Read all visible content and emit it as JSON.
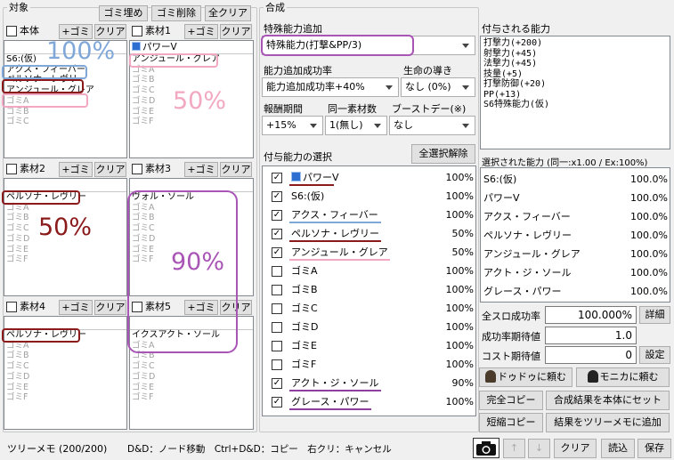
{
  "target": {
    "group_label": "対象",
    "buttons": [
      "ゴミ埋め",
      "ゴミ削除",
      "全クリア"
    ],
    "slot_buttons": {
      "add_gomi": "+ゴミ",
      "clear": "クリア"
    },
    "slots": [
      {
        "name": "本体",
        "header": "",
        "items": [
          "S6:(仮)",
          "アクス・フィーバー",
          "ペルソナ・レヴリー",
          "アンジュール・グレア"
        ],
        "gomi": [
          "ゴミA",
          "ゴミB",
          "ゴミC"
        ],
        "annotation": "100%",
        "annotation_color": "#7fa7d8"
      },
      {
        "name": "素材1",
        "header": "パワーV",
        "items": [
          "アンジュール・グレア"
        ],
        "gomi": [
          "ゴミA",
          "ゴミB",
          "ゴミC",
          "ゴミD",
          "ゴミE",
          "ゴミF"
        ],
        "annotation": "50%",
        "annotation_color": "#f2a8c0"
      },
      {
        "name": "素材2",
        "header": "ペルソナ・レヴリー",
        "items": [],
        "gomi": [
          "ゴミA",
          "ゴミB",
          "ゴミC",
          "ゴミD",
          "ゴミE",
          "ゴミF"
        ],
        "annotation": "50%",
        "annotation_color": "#8b1a1a"
      },
      {
        "name": "素材3",
        "header": "ヴォル・ソール",
        "items": [],
        "gomi": [
          "ゴミA",
          "ゴミB",
          "ゴミC",
          "ゴミD",
          "ゴミE",
          "ゴミF"
        ],
        "annotation": "90%",
        "annotation_color": "#a855b5"
      },
      {
        "name": "素材4",
        "header": "ペルソナ・レヴリー",
        "items": [],
        "gomi": [
          "ゴミA",
          "ゴミB",
          "ゴミC",
          "ゴミD",
          "ゴミE",
          "ゴミF"
        ],
        "annotation": "",
        "annotation_color": ""
      },
      {
        "name": "素材5",
        "header": "イクスアクト・ソール",
        "items": [],
        "gomi": [
          "ゴミA",
          "ゴミB",
          "ゴミC",
          "ゴミD",
          "ゴミE",
          "ゴミF"
        ],
        "annotation": "",
        "annotation_color": ""
      }
    ]
  },
  "synthesis": {
    "group_label": "合成",
    "special_label": "特殊能力追加",
    "special_value": "特殊能力(打撃&PP/3)",
    "rate_label": "能力追加成功率",
    "rate_value": "能力追加成功率+40%",
    "guide_label": "生命の導き",
    "guide_value": "なし (0%)",
    "bonus_label": "報酬期間",
    "bonus_value": "+15%",
    "same_label": "同一素材数",
    "same_value": "1(無し)",
    "boost_label": "ブーストデー(※)",
    "boost_value": "なし",
    "select_label": "付与能力の選択",
    "deselect_all": "全選択解除",
    "abilities": [
      {
        "name": "パワーV",
        "value": "100%",
        "checked": true,
        "icon": true,
        "underline": "#8b1a1a"
      },
      {
        "name": "S6:(仮)",
        "value": "100%",
        "checked": true,
        "icon": false,
        "underline": ""
      },
      {
        "name": "アクス・フィーバー",
        "value": "100%",
        "checked": true,
        "icon": false,
        "underline": "#7fa7d8"
      },
      {
        "name": "ペルソナ・レヴリー",
        "value": "50%",
        "checked": true,
        "icon": false,
        "underline": "#8b1a1a"
      },
      {
        "name": "アンジュール・グレア",
        "value": "50%",
        "checked": true,
        "icon": false,
        "underline": "#f2a8c0"
      },
      {
        "name": "ゴミA",
        "value": "100%",
        "checked": false,
        "icon": false,
        "underline": ""
      },
      {
        "name": "ゴミB",
        "value": "100%",
        "checked": false,
        "icon": false,
        "underline": ""
      },
      {
        "name": "ゴミC",
        "value": "100%",
        "checked": false,
        "icon": false,
        "underline": ""
      },
      {
        "name": "ゴミD",
        "value": "100%",
        "checked": false,
        "icon": false,
        "underline": ""
      },
      {
        "name": "ゴミE",
        "value": "100%",
        "checked": false,
        "icon": false,
        "underline": ""
      },
      {
        "name": "ゴミF",
        "value": "100%",
        "checked": false,
        "icon": false,
        "underline": ""
      },
      {
        "name": "アクト・ジ・ソール",
        "value": "90%",
        "checked": true,
        "icon": false,
        "underline": "#8e3fa0"
      },
      {
        "name": "グレース・パワー",
        "value": "100%",
        "checked": true,
        "icon": false,
        "underline": "#8e3fa0"
      }
    ]
  },
  "granted": {
    "label": "付与される能力",
    "lines": [
      "打撃力(+200)",
      "射撃力(+45)",
      "法撃力(+45)",
      "技量(+5)",
      "打撃防御(+20)",
      "PP(+13)",
      "S6特殊能力(仮)"
    ]
  },
  "selected": {
    "label": "選択された能力 (同一:x1.00 / Ex:100%)",
    "items": [
      {
        "name": "S6:(仮)",
        "value": "100.0%"
      },
      {
        "name": "パワーV",
        "value": "100.0%"
      },
      {
        "name": "アクス・フィーバー",
        "value": "100.0%"
      },
      {
        "name": "ペルソナ・レヴリー",
        "value": "100.0%"
      },
      {
        "name": "アンジュール・グレア",
        "value": "100.0%"
      },
      {
        "name": "アクト・ジ・ソール",
        "value": "100.0%"
      },
      {
        "name": "グレース・パワー",
        "value": "100.0%"
      }
    ]
  },
  "stats": {
    "all_slot_label": "全スロ成功率",
    "all_slot_value": "100.000%",
    "detail": "詳細",
    "expect_label": "成功率期待値",
    "expect_value": "1.0",
    "cost_label": "コスト期待値",
    "cost_value": "0",
    "setting": "設定"
  },
  "actions": {
    "dodoo": "ドゥドゥに頼む",
    "monika": "モニカに頼む",
    "full_copy": "完全コピー",
    "set_result": "合成結果を本体にセット",
    "short_copy": "短縮コピー",
    "add_memo": "結果をツリーメモに追加"
  },
  "status": {
    "memo": "ツリーメモ (200/200)",
    "hint": "D&D：ノード移動　Ctrl+D&D：コピー　右クリ：キャンセル",
    "up": "↑",
    "down": "↓",
    "clear": "クリア",
    "load": "読込",
    "save": "保存"
  },
  "colors": {
    "red": "#8b1a1a",
    "blue": "#7fa7d8",
    "pink": "#f2a8c0",
    "purple": "#a855b5"
  }
}
